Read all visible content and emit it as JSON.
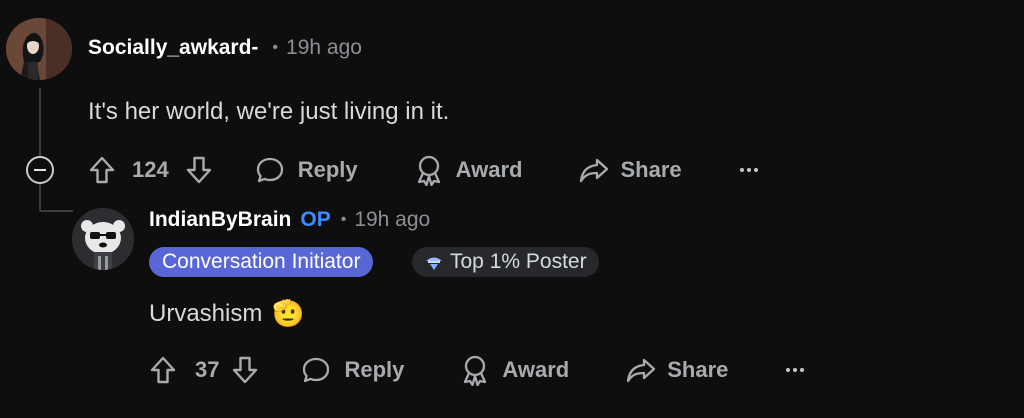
{
  "comment1": {
    "username": "Socially_awkard-",
    "separator": "•",
    "time": "19h ago",
    "body": "It's her world, we're just living in it.",
    "votes": "124",
    "reply_label": "Reply",
    "award_label": "Award",
    "share_label": "Share"
  },
  "comment2": {
    "username": "IndianByBrain",
    "op_badge": "OP",
    "separator": "•",
    "time": "19h ago",
    "flairs": [
      {
        "label": "Conversation Initiator",
        "color": "#5966d6"
      },
      {
        "label": "Top 1% Poster",
        "icon": "gem-hat-icon"
      }
    ],
    "body": "Urvashism",
    "body_emoji": "🫡",
    "votes": "37",
    "reply_label": "Reply",
    "award_label": "Award",
    "share_label": "Share"
  },
  "colors": {
    "background": "#0e0e0f",
    "op_badge": "#3d8bff",
    "flair_purple": "#5966d6",
    "muted": "#8b8f93"
  }
}
